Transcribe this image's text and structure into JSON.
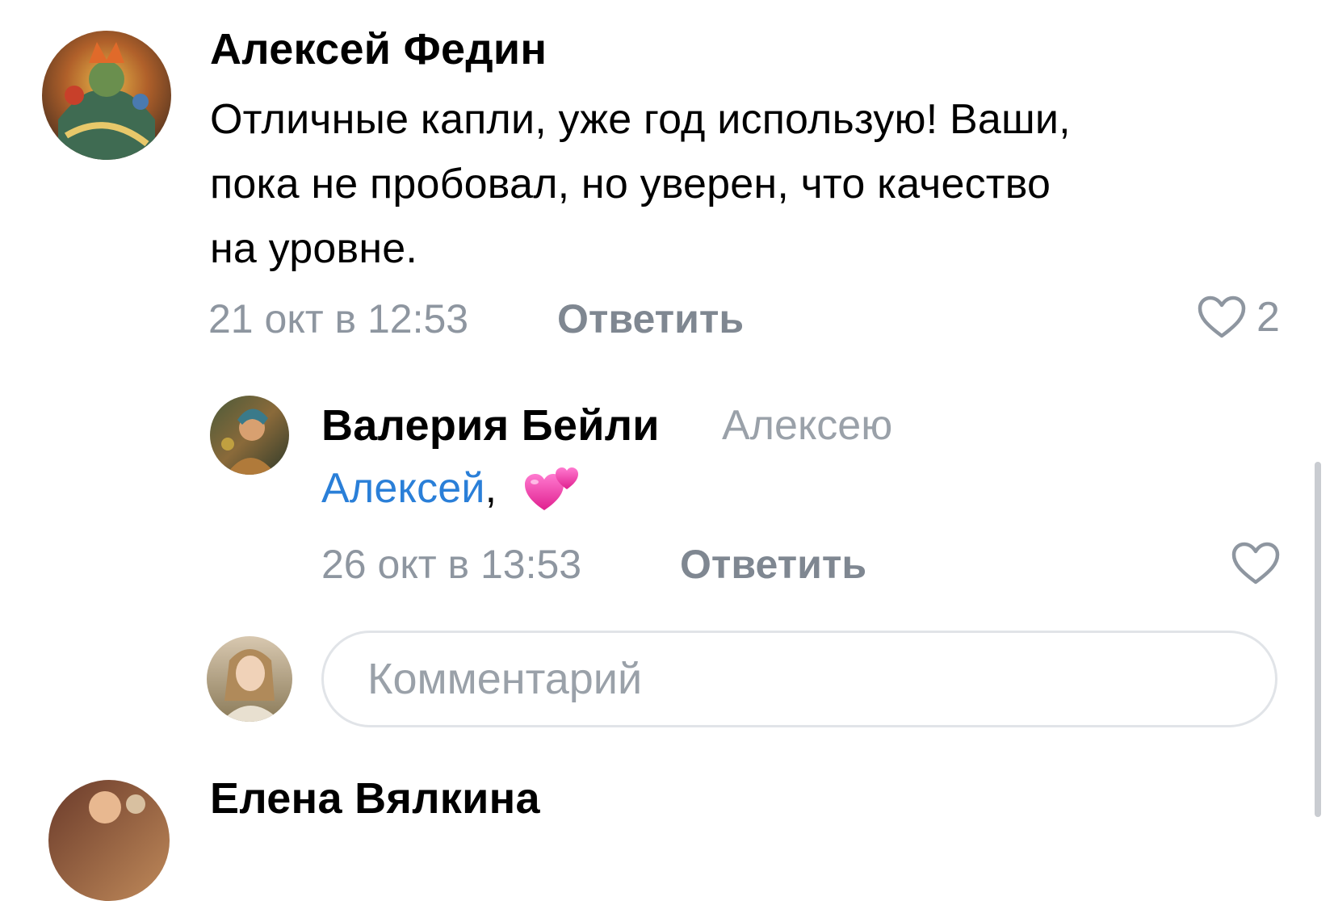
{
  "comments": [
    {
      "author": "Алексей Федин",
      "text_lines": [
        "Отличные капли, уже год использую! Ваши,",
        "пока не пробовал, но уверен, что качество",
        "на уровне."
      ],
      "time": "21 окт в 12:53",
      "reply_label": "Ответить",
      "likes": "2",
      "avatar_icon": "avatar-aleksey"
    }
  ],
  "reply": {
    "author": "Валерия Бейли",
    "addressee": "Алексею",
    "mention": "Алексей",
    "mention_suffix": ",",
    "emoji": "💞",
    "time": "26 окт в 13:53",
    "reply_label": "Ответить",
    "avatar_icon": "avatar-valeria"
  },
  "composer": {
    "placeholder": "Комментарий",
    "avatar_icon": "avatar-current-user"
  },
  "next_comment": {
    "author": "Елена Вялкина",
    "avatar_icon": "avatar-elena"
  },
  "colors": {
    "meta": "#8e96a0",
    "link": "#2a7fd8",
    "reply_button": "#7f8791",
    "heart_outline": "#8e96a0",
    "input_border": "#e1e4e8"
  },
  "icons": {
    "like": "heart-outline-icon",
    "emoji": "two-hearts-emoji"
  }
}
